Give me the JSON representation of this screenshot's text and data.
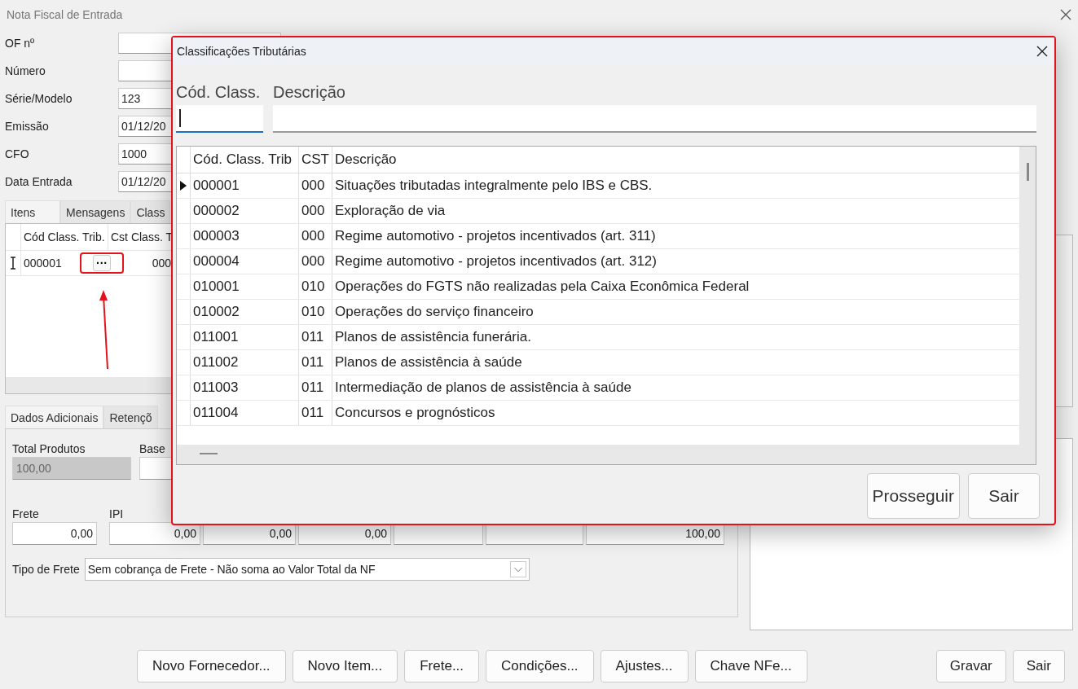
{
  "window": {
    "title": "Nota Fiscal de Entrada"
  },
  "form_fields": [
    {
      "label": "OF nº"
    },
    {
      "label": "Número"
    },
    {
      "label": "Série/Modelo",
      "value": "123"
    },
    {
      "label": "Emissão",
      "value": "01/12/20"
    },
    {
      "label": "CFO",
      "value": "1000"
    },
    {
      "label": "Data Entrada",
      "value": "01/12/20"
    }
  ],
  "item_tabs": [
    {
      "label": "Itens",
      "selected": true
    },
    {
      "label": "Mensagens",
      "selected": false
    },
    {
      "label": "Class",
      "selected": false
    }
  ],
  "items_grid": {
    "columns": [
      "Cód Class. Trib.",
      "Cst Class. T"
    ],
    "rows": [
      {
        "code": "000001",
        "button": "···",
        "cst": "000"
      }
    ]
  },
  "additional_tabs": [
    {
      "label": "Dados Adicionais",
      "selected": true
    },
    {
      "label": "Retençõ",
      "selected": false
    }
  ],
  "totals": {
    "total_produtos": {
      "label": "Total Produtos",
      "value": "100,00",
      "disabled": true
    },
    "base": {
      "label": "Base",
      "disabled": false
    },
    "fields": [
      {
        "kind": "amount",
        "label": "Frete",
        "value": "0,00"
      },
      {
        "kind": "amount",
        "label": "IPI",
        "value": "0,00"
      },
      {
        "kind": "amount",
        "value": "0,00"
      },
      {
        "kind": "amount",
        "value": "0,00"
      },
      {
        "kind": "blank"
      },
      {
        "kind": "blank"
      },
      {
        "kind": "amount",
        "value": "100,00"
      }
    ]
  },
  "tipo_frete": {
    "label": "Tipo de Frete",
    "value": "Sem cobrança de Frete - Não soma ao Valor Total da NF"
  },
  "buttons": [
    "Novo Fornecedor...",
    "Novo Item...",
    "Frete...",
    "Condições...",
    "Ajustes...",
    "Chave NFe..."
  ],
  "right_buttons": [
    "Gravar",
    "Sair"
  ],
  "dialog": {
    "title": "Classificações Tributárias",
    "filters": [
      {
        "label": "Cód. Class.",
        "focused": true
      },
      {
        "label": "Descrição",
        "focused": false
      }
    ],
    "columns": [
      "Cód. Class. Trib",
      "CST",
      "Descrição"
    ],
    "rows": [
      {
        "code": "000001",
        "cst": "000",
        "description": "Situações tributadas integralmente pelo IBS e CBS.",
        "selected": true
      },
      {
        "code": "000002",
        "cst": "000",
        "description": "Exploração de via",
        "selected": false
      },
      {
        "code": "000003",
        "cst": "000",
        "description": "Regime automotivo - projetos incentivados (art. 311)",
        "selected": false
      },
      {
        "code": "000004",
        "cst": "000",
        "description": "Regime automotivo - projetos incentivados (art. 312)",
        "selected": false
      },
      {
        "code": "010001",
        "cst": "010",
        "description": "Operações do FGTS não realizadas pela Caixa Econômica Federal",
        "selected": false
      },
      {
        "code": "010002",
        "cst": "010",
        "description": "Operações do serviço financeiro",
        "selected": false
      },
      {
        "code": "011001",
        "cst": "011",
        "description": "Planos de assistência funerária.",
        "selected": false
      },
      {
        "code": "011002",
        "cst": "011",
        "description": "Planos de assistência à saúde",
        "selected": false
      },
      {
        "code": "011003",
        "cst": "011",
        "description": "Intermediação de planos de assistência à saúde",
        "selected": false
      },
      {
        "code": "011004",
        "cst": "011",
        "description": "Concursos e prognósticos",
        "selected": false
      }
    ],
    "buttons": [
      "Prosseguir",
      "Sair"
    ]
  }
}
